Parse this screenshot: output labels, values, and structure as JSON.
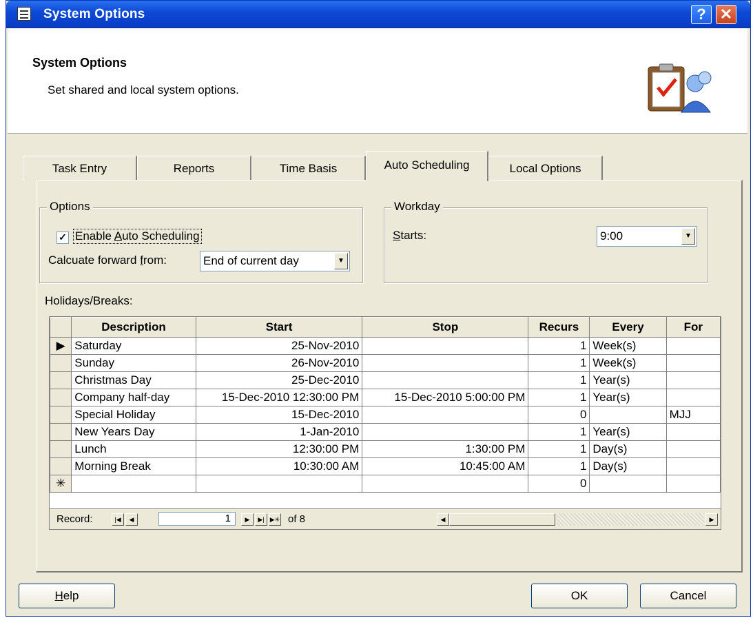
{
  "window": {
    "title": "System Options"
  },
  "header": {
    "title": "System Options",
    "subtitle": "Set shared and local system options."
  },
  "tabs": [
    {
      "label": "Task Entry",
      "active": false
    },
    {
      "label": "Reports",
      "active": false
    },
    {
      "label": "Time Basis",
      "active": false
    },
    {
      "label": "Auto Scheduling",
      "active": true
    },
    {
      "label": "Local Options",
      "active": false
    }
  ],
  "options": {
    "legend": "Options",
    "enable_pre": "Enable ",
    "enable_ul": "A",
    "enable_post": "uto Scheduling",
    "enable_checked": true,
    "calc_pre": "Calcuate forward ",
    "calc_ul": "f",
    "calc_post": "rom:",
    "calc_value": "End of current day"
  },
  "workday": {
    "legend": "Workday",
    "starts_ul": "S",
    "starts_post": "tarts:",
    "starts_value": "9:00"
  },
  "holidays": {
    "label": "Holidays/Breaks:",
    "columns": [
      "Description",
      "Start",
      "Stop",
      "Recurs",
      "Every",
      "For"
    ],
    "rows": [
      {
        "description": "Saturday",
        "start": "25-Nov-2010",
        "stop": "",
        "recurs": "1",
        "every": "Week(s)",
        "for": ""
      },
      {
        "description": "Sunday",
        "start": "26-Nov-2010",
        "stop": "",
        "recurs": "1",
        "every": "Week(s)",
        "for": ""
      },
      {
        "description": "Christmas Day",
        "start": "25-Dec-2010",
        "stop": "",
        "recurs": "1",
        "every": "Year(s)",
        "for": ""
      },
      {
        "description": "Company half-day",
        "start": "15-Dec-2010 12:30:00 PM",
        "stop": "15-Dec-2010 5:00:00 PM",
        "recurs": "1",
        "every": "Year(s)",
        "for": ""
      },
      {
        "description": "Special Holiday",
        "start": "15-Dec-2010",
        "stop": "",
        "recurs": "0",
        "every": "",
        "for": "MJJ"
      },
      {
        "description": "New Years Day",
        "start": "1-Jan-2010",
        "stop": "",
        "recurs": "1",
        "every": "Year(s)",
        "for": ""
      },
      {
        "description": "Lunch",
        "start": "12:30:00 PM",
        "stop": "1:30:00 PM",
        "recurs": "1",
        "every": "Day(s)",
        "for": ""
      },
      {
        "description": "Morning Break",
        "start": "10:30:00 AM",
        "stop": "10:45:00 AM",
        "recurs": "1",
        "every": "Day(s)",
        "for": ""
      }
    ],
    "new_row_recurs": "0",
    "current_row_marker": "▶",
    "new_row_marker": "✳"
  },
  "record_nav": {
    "label": "Record:",
    "current": "1",
    "total_text": "of 8"
  },
  "buttons": {
    "help_ul": "H",
    "help_post": "elp",
    "ok": "OK",
    "cancel": "Cancel"
  }
}
